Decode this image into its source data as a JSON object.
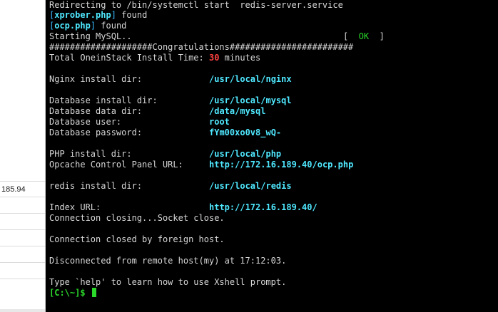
{
  "left_panel": {
    "rows": [
      "185.94",
      "",
      "",
      "",
      "",
      "",
      "",
      "",
      ""
    ]
  },
  "terminal": {
    "l1": "Redirecting to /bin/systemctl start  redis-server.service",
    "l2_file": "xprober.php",
    "l2_rest": " found",
    "l3_file": "ocp.php",
    "l3_rest": " found",
    "l4_text": "Starting MySQL..",
    "l4_status_open": "[  ",
    "l4_status": "OK",
    "l4_status_close": "  ]",
    "l5": "####################Congratulations########################",
    "l6_label": "Total OneinStack Install Time: ",
    "l6_value": "30",
    "l6_unit": " minutes",
    "nginx_label": "Nginx install dir:",
    "nginx_value": "/usr/local/nginx",
    "db_install_label": "Database install dir:",
    "db_install_value": "/usr/local/mysql",
    "db_data_label": "Database data dir:",
    "db_data_value": "/data/mysql",
    "db_user_label": "Database user:",
    "db_user_value": "root",
    "db_pass_label": "Database password:",
    "db_pass_value": "fYm00xo0v8_wQ-",
    "php_label": "PHP install dir:",
    "php_value": "/usr/local/php",
    "opcache_label": "Opcache Control Panel URL:",
    "opcache_value": "http://172.16.189.40/ocp.php",
    "redis_label": "redis install dir:",
    "redis_value": "/usr/local/redis",
    "index_label": "Index URL:",
    "index_value": "http://172.16.189.40/",
    "closing": "Connection closing...Socket close.",
    "closed": "Connection closed by foreign host.",
    "disconnected": "Disconnected from remote host(my) at 17:12:03.",
    "help": "Type `help' to learn how to use Xshell prompt.",
    "prompt": "[C:\\~]$ "
  },
  "colors": {
    "background": "#000000",
    "text": "#d7d7d7",
    "highlight": "#4fe8ff",
    "ok": "#2bd92b",
    "time": "#ff4040"
  }
}
